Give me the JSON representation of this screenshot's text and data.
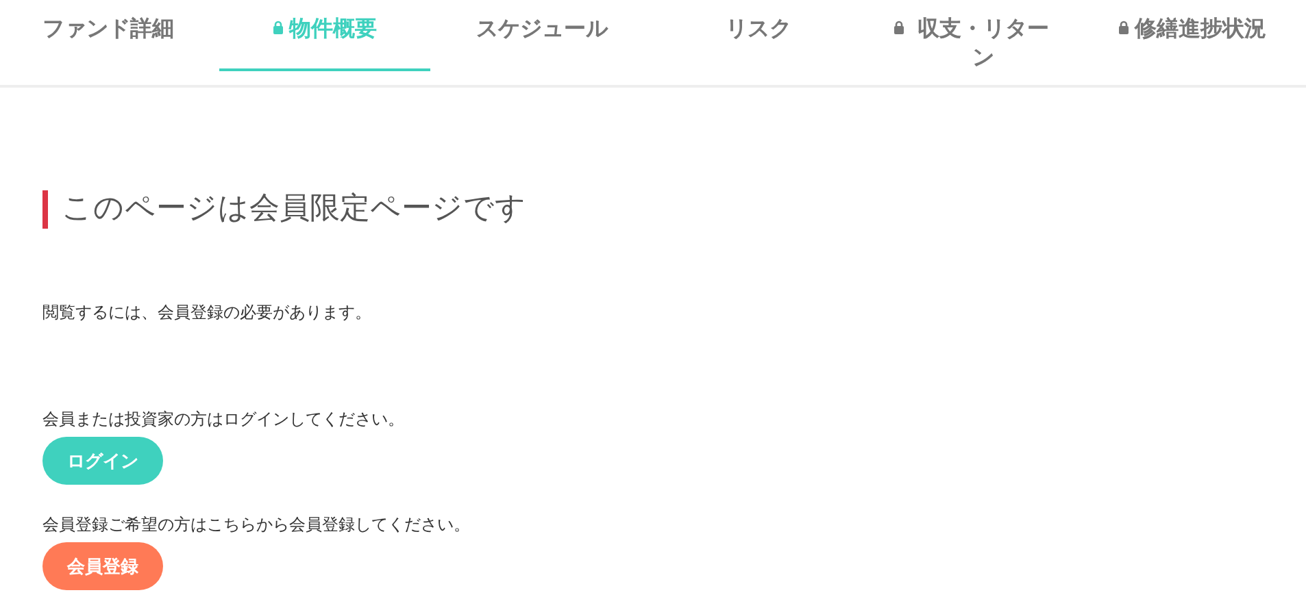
{
  "tabs": [
    {
      "label": "ファンド詳細",
      "locked": false,
      "selected": false
    },
    {
      "label": "物件概要",
      "locked": true,
      "selected": true
    },
    {
      "label": "スケジュール",
      "locked": false,
      "selected": false
    },
    {
      "label": "リスク",
      "locked": false,
      "selected": false
    },
    {
      "label": "収支・リターン",
      "locked": true,
      "selected": false
    },
    {
      "label": "修繕進捗状況",
      "locked": true,
      "selected": false
    }
  ],
  "heading": "このページは会員限定ページです",
  "notice": "閲覧するには、会員登録の必要があります。",
  "actions": [
    {
      "prompt": "会員または投資家の方はログインしてください。",
      "button": "ログイン",
      "kind": "login"
    },
    {
      "prompt": "会員登録ご希望の方はこちらから会員登録してください。",
      "button": "会員登録",
      "kind": "register"
    }
  ]
}
